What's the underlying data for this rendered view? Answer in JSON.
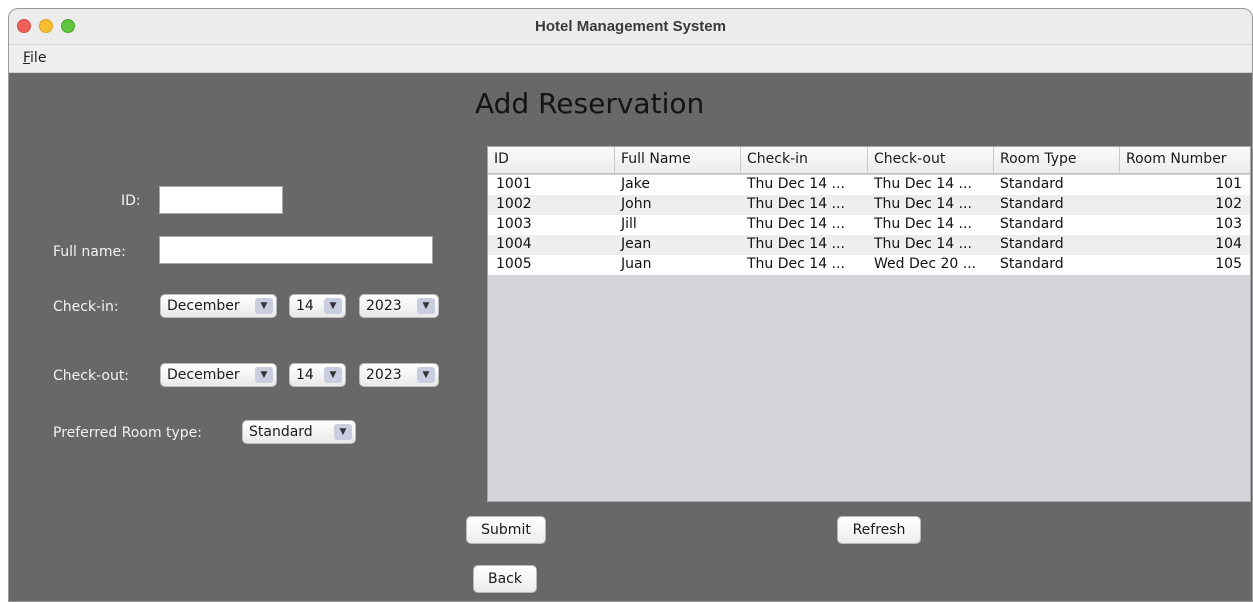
{
  "window": {
    "title": "Hotel Management System"
  },
  "menubar": {
    "file_prefix": "F",
    "file_rest": "ile"
  },
  "form": {
    "heading": "Add Reservation",
    "id_label": "ID:",
    "id_value": "",
    "fullname_label": "Full name:",
    "fullname_value": "",
    "checkin_label": "Check-in:",
    "checkin_month": "December",
    "checkin_day": "14",
    "checkin_year": "2023",
    "checkout_label": "Check-out:",
    "checkout_month": "December",
    "checkout_day": "14",
    "checkout_year": "2023",
    "roomtype_label": "Preferred Room type:",
    "roomtype_value": "Standard"
  },
  "table": {
    "columns": [
      "ID",
      "Full Name",
      "Check-in",
      "Check-out",
      "Room Type",
      "Room Number"
    ],
    "rows": [
      [
        "1001",
        "Jake",
        "Thu Dec 14 ...",
        "Thu Dec 14 ...",
        "Standard",
        "101"
      ],
      [
        "1002",
        "John",
        "Thu Dec 14 ...",
        "Thu Dec 14 ...",
        "Standard",
        "102"
      ],
      [
        "1003",
        "Jill",
        "Thu Dec 14 ...",
        "Thu Dec 14 ...",
        "Standard",
        "103"
      ],
      [
        "1004",
        "Jean",
        "Thu Dec 14 ...",
        "Thu Dec 14 ...",
        "Standard",
        "104"
      ],
      [
        "1005",
        "Juan",
        "Thu Dec 14 ...",
        "Wed Dec 20 ...",
        "Standard",
        "105"
      ]
    ]
  },
  "buttons": {
    "submit": "Submit",
    "refresh": "Refresh",
    "back": "Back"
  },
  "icons": {
    "dropdown": "chevron-down-icon"
  }
}
